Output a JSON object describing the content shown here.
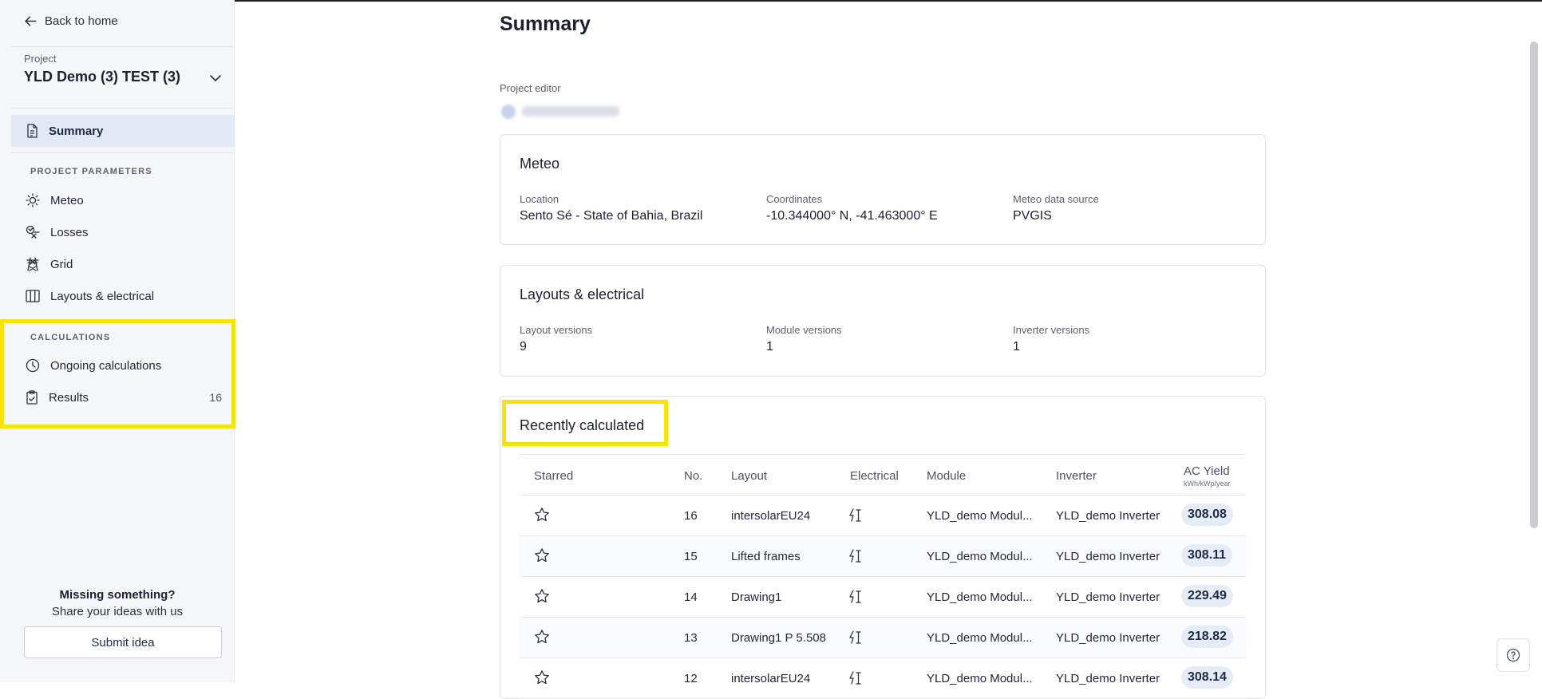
{
  "sidebar": {
    "back_label": "Back to home",
    "project_label": "Project",
    "project_name": "YLD Demo (3) TEST (3)",
    "summary_label": "Summary",
    "params_section": "PROJECT PARAMETERS",
    "params_items": [
      {
        "label": "Meteo",
        "icon": "sun-icon"
      },
      {
        "label": "Losses",
        "icon": "losses-icon"
      },
      {
        "label": "Grid",
        "icon": "pylon-icon"
      },
      {
        "label": "Layouts & electrical",
        "icon": "columns-icon"
      }
    ],
    "calc_section": "CALCULATIONS",
    "ongoing_label": "Ongoing calculations",
    "results_label": "Results",
    "results_count": "16",
    "missing_title": "Missing something?",
    "missing_sub": "Share your ideas with us",
    "submit_label": "Submit idea",
    "highlight_color": "#f7e400"
  },
  "main": {
    "title": "Summary",
    "editor_label": "Project editor",
    "meteo": {
      "title": "Meteo",
      "location_label": "Location",
      "location_value": "Sento Sé - State of Bahia, Brazil",
      "coords_label": "Coordinates",
      "coords_value": "-10.344000° N, -41.463000° E",
      "source_label": "Meteo data source",
      "source_value": "PVGIS"
    },
    "layouts": {
      "title": "Layouts & electrical",
      "layout_label": "Layout versions",
      "layout_value": "9",
      "module_label": "Module versions",
      "module_value": "1",
      "inverter_label": "Inverter versions",
      "inverter_value": "1"
    },
    "recent": {
      "title": "Recently calculated",
      "columns": {
        "starred": "Starred",
        "no": "No.",
        "layout": "Layout",
        "electrical": "Electrical",
        "module": "Module",
        "inverter": "Inverter",
        "ac_yield": "AC Yield",
        "ac_yield_unit": "kWh/kWp/year"
      },
      "rows": [
        {
          "no": "16",
          "layout": "intersolarEU24",
          "module": "YLD_demo Modul...",
          "inverter": "YLD_demo Inverter",
          "ac_yield": "308.08"
        },
        {
          "no": "15",
          "layout": "Lifted frames",
          "module": "YLD_demo Modul...",
          "inverter": "YLD_demo Inverter",
          "ac_yield": "308.11"
        },
        {
          "no": "14",
          "layout": "Drawing1",
          "module": "YLD_demo Modul...",
          "inverter": "YLD_demo Inverter",
          "ac_yield": "229.49"
        },
        {
          "no": "13",
          "layout": "Drawing1 P 5.508",
          "module": "YLD_demo Modul...",
          "inverter": "YLD_demo Inverter",
          "ac_yield": "218.82"
        },
        {
          "no": "12",
          "layout": "intersolarEU24",
          "module": "YLD_demo Modul...",
          "inverter": "YLD_demo Inverter",
          "ac_yield": "308.14"
        }
      ]
    }
  }
}
